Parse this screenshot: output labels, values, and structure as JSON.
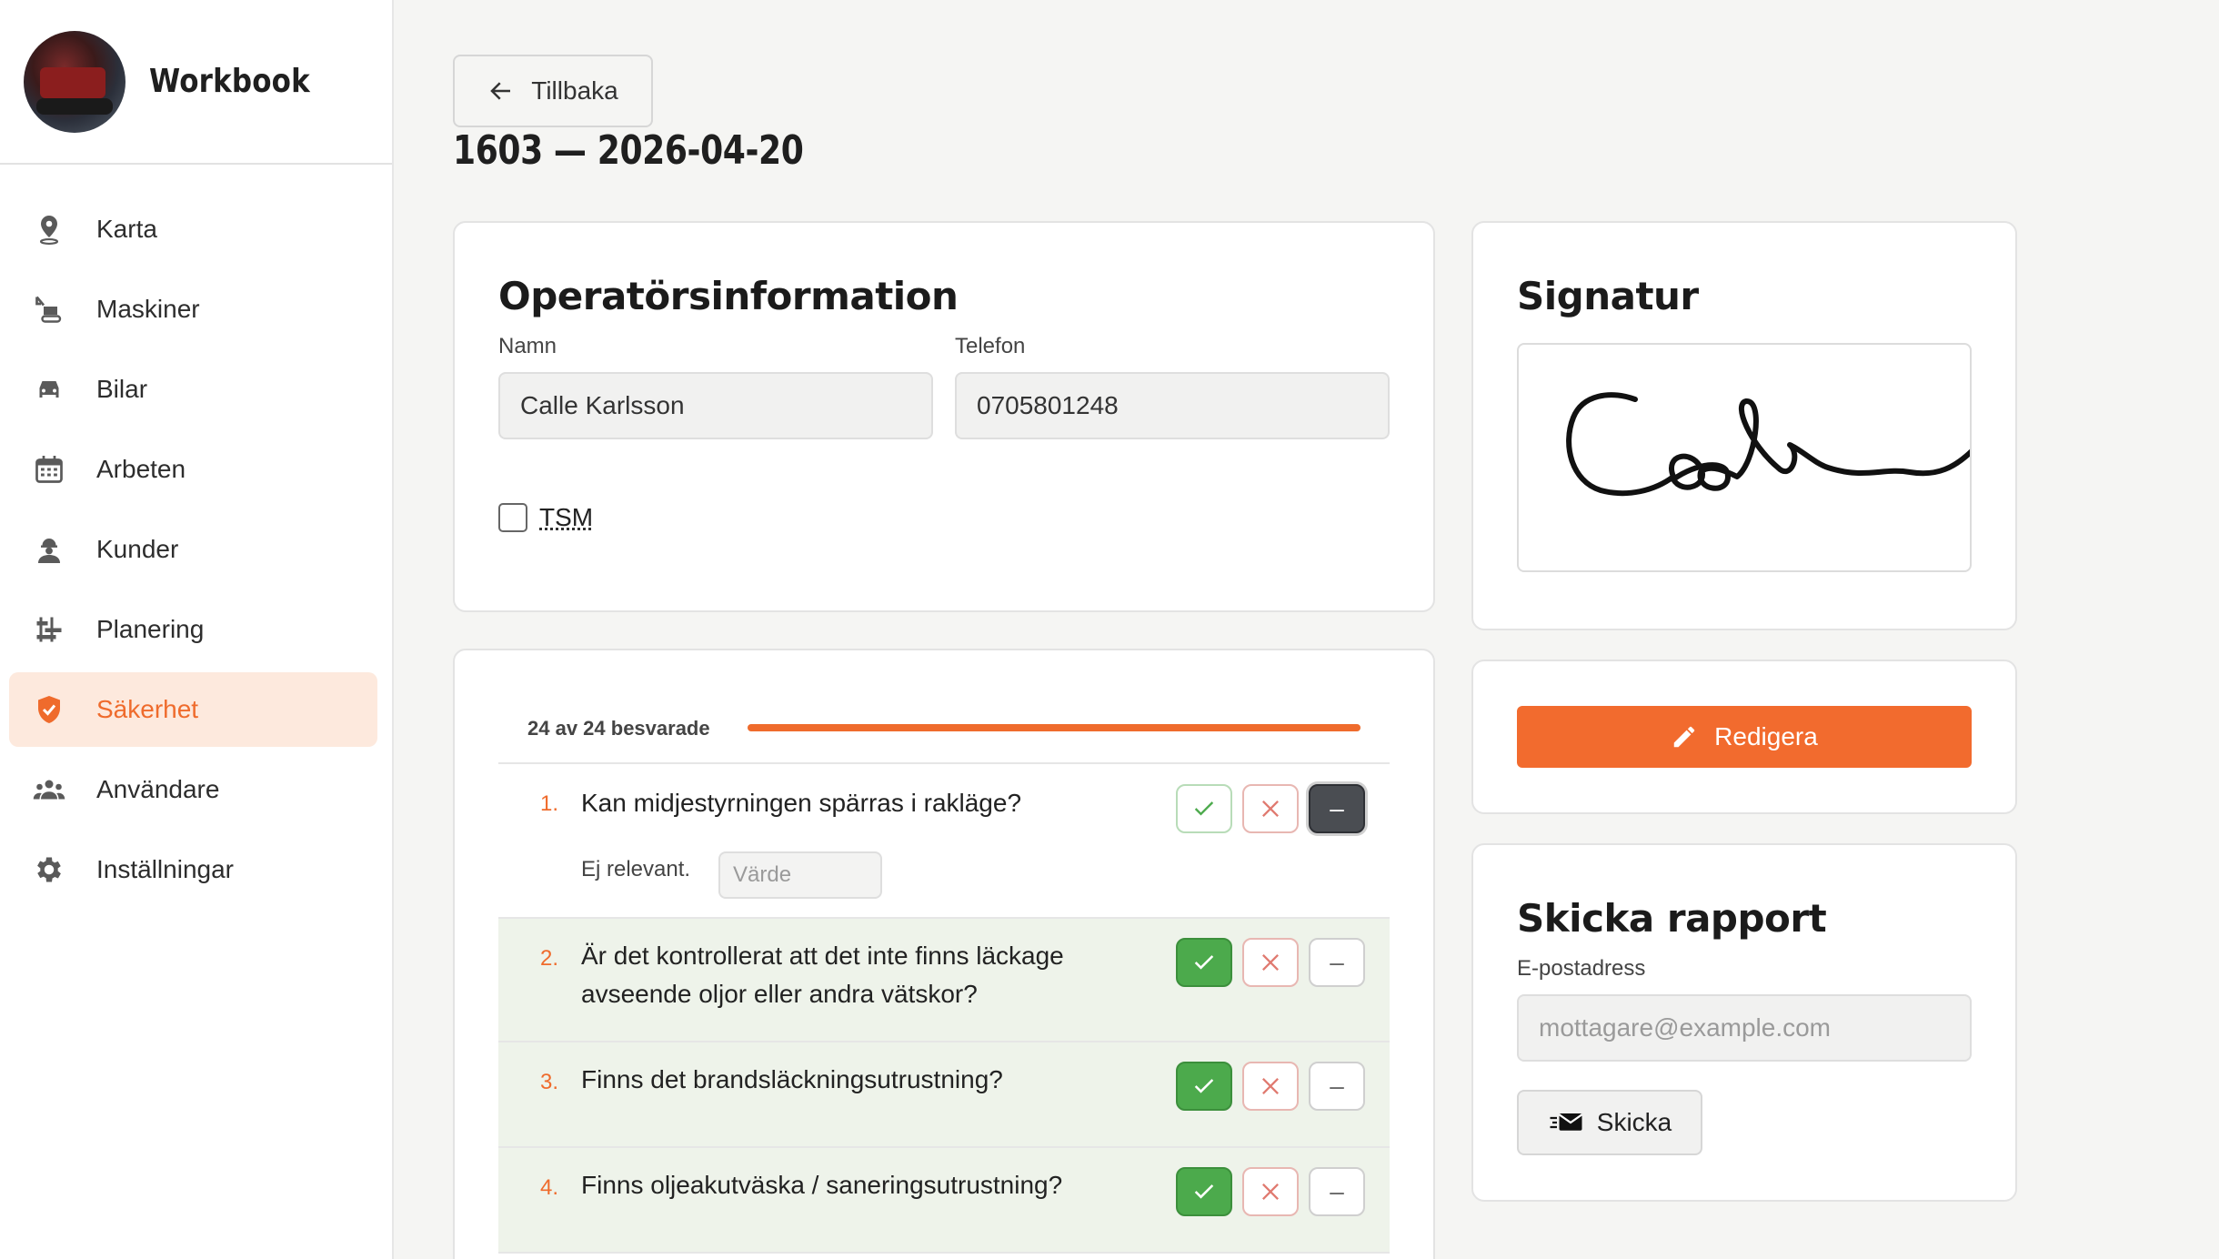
{
  "brand": {
    "name": "Workbook"
  },
  "sidebar": {
    "items": [
      {
        "label": "Karta",
        "icon": "map-pin-icon"
      },
      {
        "label": "Maskiner",
        "icon": "excavator-icon"
      },
      {
        "label": "Bilar",
        "icon": "car-icon"
      },
      {
        "label": "Arbeten",
        "icon": "calendar-icon"
      },
      {
        "label": "Kunder",
        "icon": "worker-icon"
      },
      {
        "label": "Planering",
        "icon": "planning-icon"
      },
      {
        "label": "Säkerhet",
        "icon": "shield-check-icon",
        "active": true
      },
      {
        "label": "Användare",
        "icon": "users-icon"
      },
      {
        "label": "Inställningar",
        "icon": "gear-icon"
      }
    ]
  },
  "header": {
    "back_label": "Tillbaka",
    "title": "1603 — 2026-04-20"
  },
  "operator": {
    "title": "Operatörsinformation",
    "name_label": "Namn",
    "name_value": "Calle Karlsson",
    "phone_label": "Telefon",
    "phone_value": "0705801248",
    "tsm_label": "TSM",
    "tsm_checked": false
  },
  "checklist": {
    "progress_label": "24 av 24 besvarade",
    "progress": 1.0,
    "questions": [
      {
        "num": "1.",
        "text": "Kan midjestyrningen spärras i rakläge?",
        "answer": "na",
        "note_label": "Ej relevant.",
        "note_placeholder": "Värde"
      },
      {
        "num": "2.",
        "text": "Är det kontrollerat att det inte finns läckage avseende oljor eller andra vätskor?",
        "answer": "yes"
      },
      {
        "num": "3.",
        "text": "Finns det brandsläckningsutrustning?",
        "answer": "yes"
      },
      {
        "num": "4.",
        "text": "Finns oljeakutväska / saneringsutrustning?",
        "answer": "yes"
      }
    ],
    "na_symbol": "–"
  },
  "signature": {
    "title": "Signatur"
  },
  "edit": {
    "label": "Redigera"
  },
  "report": {
    "title": "Skicka rapport",
    "email_label": "E-postadress",
    "email_placeholder": "mottagare@example.com",
    "send_label": "Skicka"
  },
  "colors": {
    "accent": "#f26b2e",
    "yes": "#4caa4c",
    "no": "#e07a70",
    "active_bg": "#fde9dd"
  }
}
